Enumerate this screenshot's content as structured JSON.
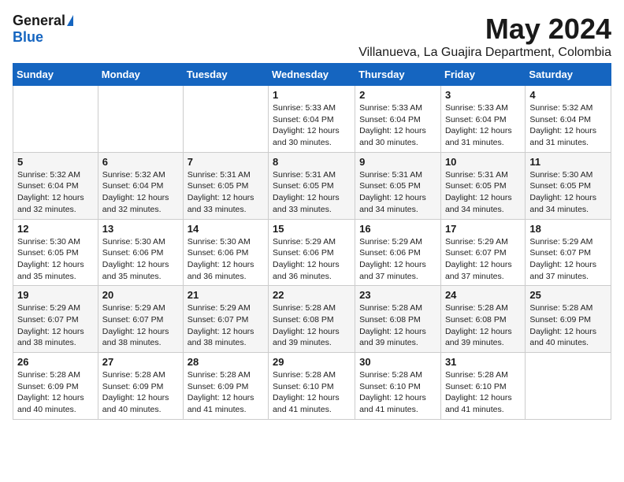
{
  "logo": {
    "general": "General",
    "blue": "Blue"
  },
  "title": {
    "month_year": "May 2024",
    "location": "Villanueva, La Guajira Department, Colombia"
  },
  "calendar": {
    "headers": [
      "Sunday",
      "Monday",
      "Tuesday",
      "Wednesday",
      "Thursday",
      "Friday",
      "Saturday"
    ],
    "weeks": [
      [
        {
          "day": "",
          "info": ""
        },
        {
          "day": "",
          "info": ""
        },
        {
          "day": "",
          "info": ""
        },
        {
          "day": "1",
          "info": "Sunrise: 5:33 AM\nSunset: 6:04 PM\nDaylight: 12 hours\nand 30 minutes."
        },
        {
          "day": "2",
          "info": "Sunrise: 5:33 AM\nSunset: 6:04 PM\nDaylight: 12 hours\nand 30 minutes."
        },
        {
          "day": "3",
          "info": "Sunrise: 5:33 AM\nSunset: 6:04 PM\nDaylight: 12 hours\nand 31 minutes."
        },
        {
          "day": "4",
          "info": "Sunrise: 5:32 AM\nSunset: 6:04 PM\nDaylight: 12 hours\nand 31 minutes."
        }
      ],
      [
        {
          "day": "5",
          "info": "Sunrise: 5:32 AM\nSunset: 6:04 PM\nDaylight: 12 hours\nand 32 minutes."
        },
        {
          "day": "6",
          "info": "Sunrise: 5:32 AM\nSunset: 6:04 PM\nDaylight: 12 hours\nand 32 minutes."
        },
        {
          "day": "7",
          "info": "Sunrise: 5:31 AM\nSunset: 6:05 PM\nDaylight: 12 hours\nand 33 minutes."
        },
        {
          "day": "8",
          "info": "Sunrise: 5:31 AM\nSunset: 6:05 PM\nDaylight: 12 hours\nand 33 minutes."
        },
        {
          "day": "9",
          "info": "Sunrise: 5:31 AM\nSunset: 6:05 PM\nDaylight: 12 hours\nand 34 minutes."
        },
        {
          "day": "10",
          "info": "Sunrise: 5:31 AM\nSunset: 6:05 PM\nDaylight: 12 hours\nand 34 minutes."
        },
        {
          "day": "11",
          "info": "Sunrise: 5:30 AM\nSunset: 6:05 PM\nDaylight: 12 hours\nand 34 minutes."
        }
      ],
      [
        {
          "day": "12",
          "info": "Sunrise: 5:30 AM\nSunset: 6:05 PM\nDaylight: 12 hours\nand 35 minutes."
        },
        {
          "day": "13",
          "info": "Sunrise: 5:30 AM\nSunset: 6:06 PM\nDaylight: 12 hours\nand 35 minutes."
        },
        {
          "day": "14",
          "info": "Sunrise: 5:30 AM\nSunset: 6:06 PM\nDaylight: 12 hours\nand 36 minutes."
        },
        {
          "day": "15",
          "info": "Sunrise: 5:29 AM\nSunset: 6:06 PM\nDaylight: 12 hours\nand 36 minutes."
        },
        {
          "day": "16",
          "info": "Sunrise: 5:29 AM\nSunset: 6:06 PM\nDaylight: 12 hours\nand 37 minutes."
        },
        {
          "day": "17",
          "info": "Sunrise: 5:29 AM\nSunset: 6:07 PM\nDaylight: 12 hours\nand 37 minutes."
        },
        {
          "day": "18",
          "info": "Sunrise: 5:29 AM\nSunset: 6:07 PM\nDaylight: 12 hours\nand 37 minutes."
        }
      ],
      [
        {
          "day": "19",
          "info": "Sunrise: 5:29 AM\nSunset: 6:07 PM\nDaylight: 12 hours\nand 38 minutes."
        },
        {
          "day": "20",
          "info": "Sunrise: 5:29 AM\nSunset: 6:07 PM\nDaylight: 12 hours\nand 38 minutes."
        },
        {
          "day": "21",
          "info": "Sunrise: 5:29 AM\nSunset: 6:07 PM\nDaylight: 12 hours\nand 38 minutes."
        },
        {
          "day": "22",
          "info": "Sunrise: 5:28 AM\nSunset: 6:08 PM\nDaylight: 12 hours\nand 39 minutes."
        },
        {
          "day": "23",
          "info": "Sunrise: 5:28 AM\nSunset: 6:08 PM\nDaylight: 12 hours\nand 39 minutes."
        },
        {
          "day": "24",
          "info": "Sunrise: 5:28 AM\nSunset: 6:08 PM\nDaylight: 12 hours\nand 39 minutes."
        },
        {
          "day": "25",
          "info": "Sunrise: 5:28 AM\nSunset: 6:09 PM\nDaylight: 12 hours\nand 40 minutes."
        }
      ],
      [
        {
          "day": "26",
          "info": "Sunrise: 5:28 AM\nSunset: 6:09 PM\nDaylight: 12 hours\nand 40 minutes."
        },
        {
          "day": "27",
          "info": "Sunrise: 5:28 AM\nSunset: 6:09 PM\nDaylight: 12 hours\nand 40 minutes."
        },
        {
          "day": "28",
          "info": "Sunrise: 5:28 AM\nSunset: 6:09 PM\nDaylight: 12 hours\nand 41 minutes."
        },
        {
          "day": "29",
          "info": "Sunrise: 5:28 AM\nSunset: 6:10 PM\nDaylight: 12 hours\nand 41 minutes."
        },
        {
          "day": "30",
          "info": "Sunrise: 5:28 AM\nSunset: 6:10 PM\nDaylight: 12 hours\nand 41 minutes."
        },
        {
          "day": "31",
          "info": "Sunrise: 5:28 AM\nSunset: 6:10 PM\nDaylight: 12 hours\nand 41 minutes."
        },
        {
          "day": "",
          "info": ""
        }
      ]
    ]
  }
}
